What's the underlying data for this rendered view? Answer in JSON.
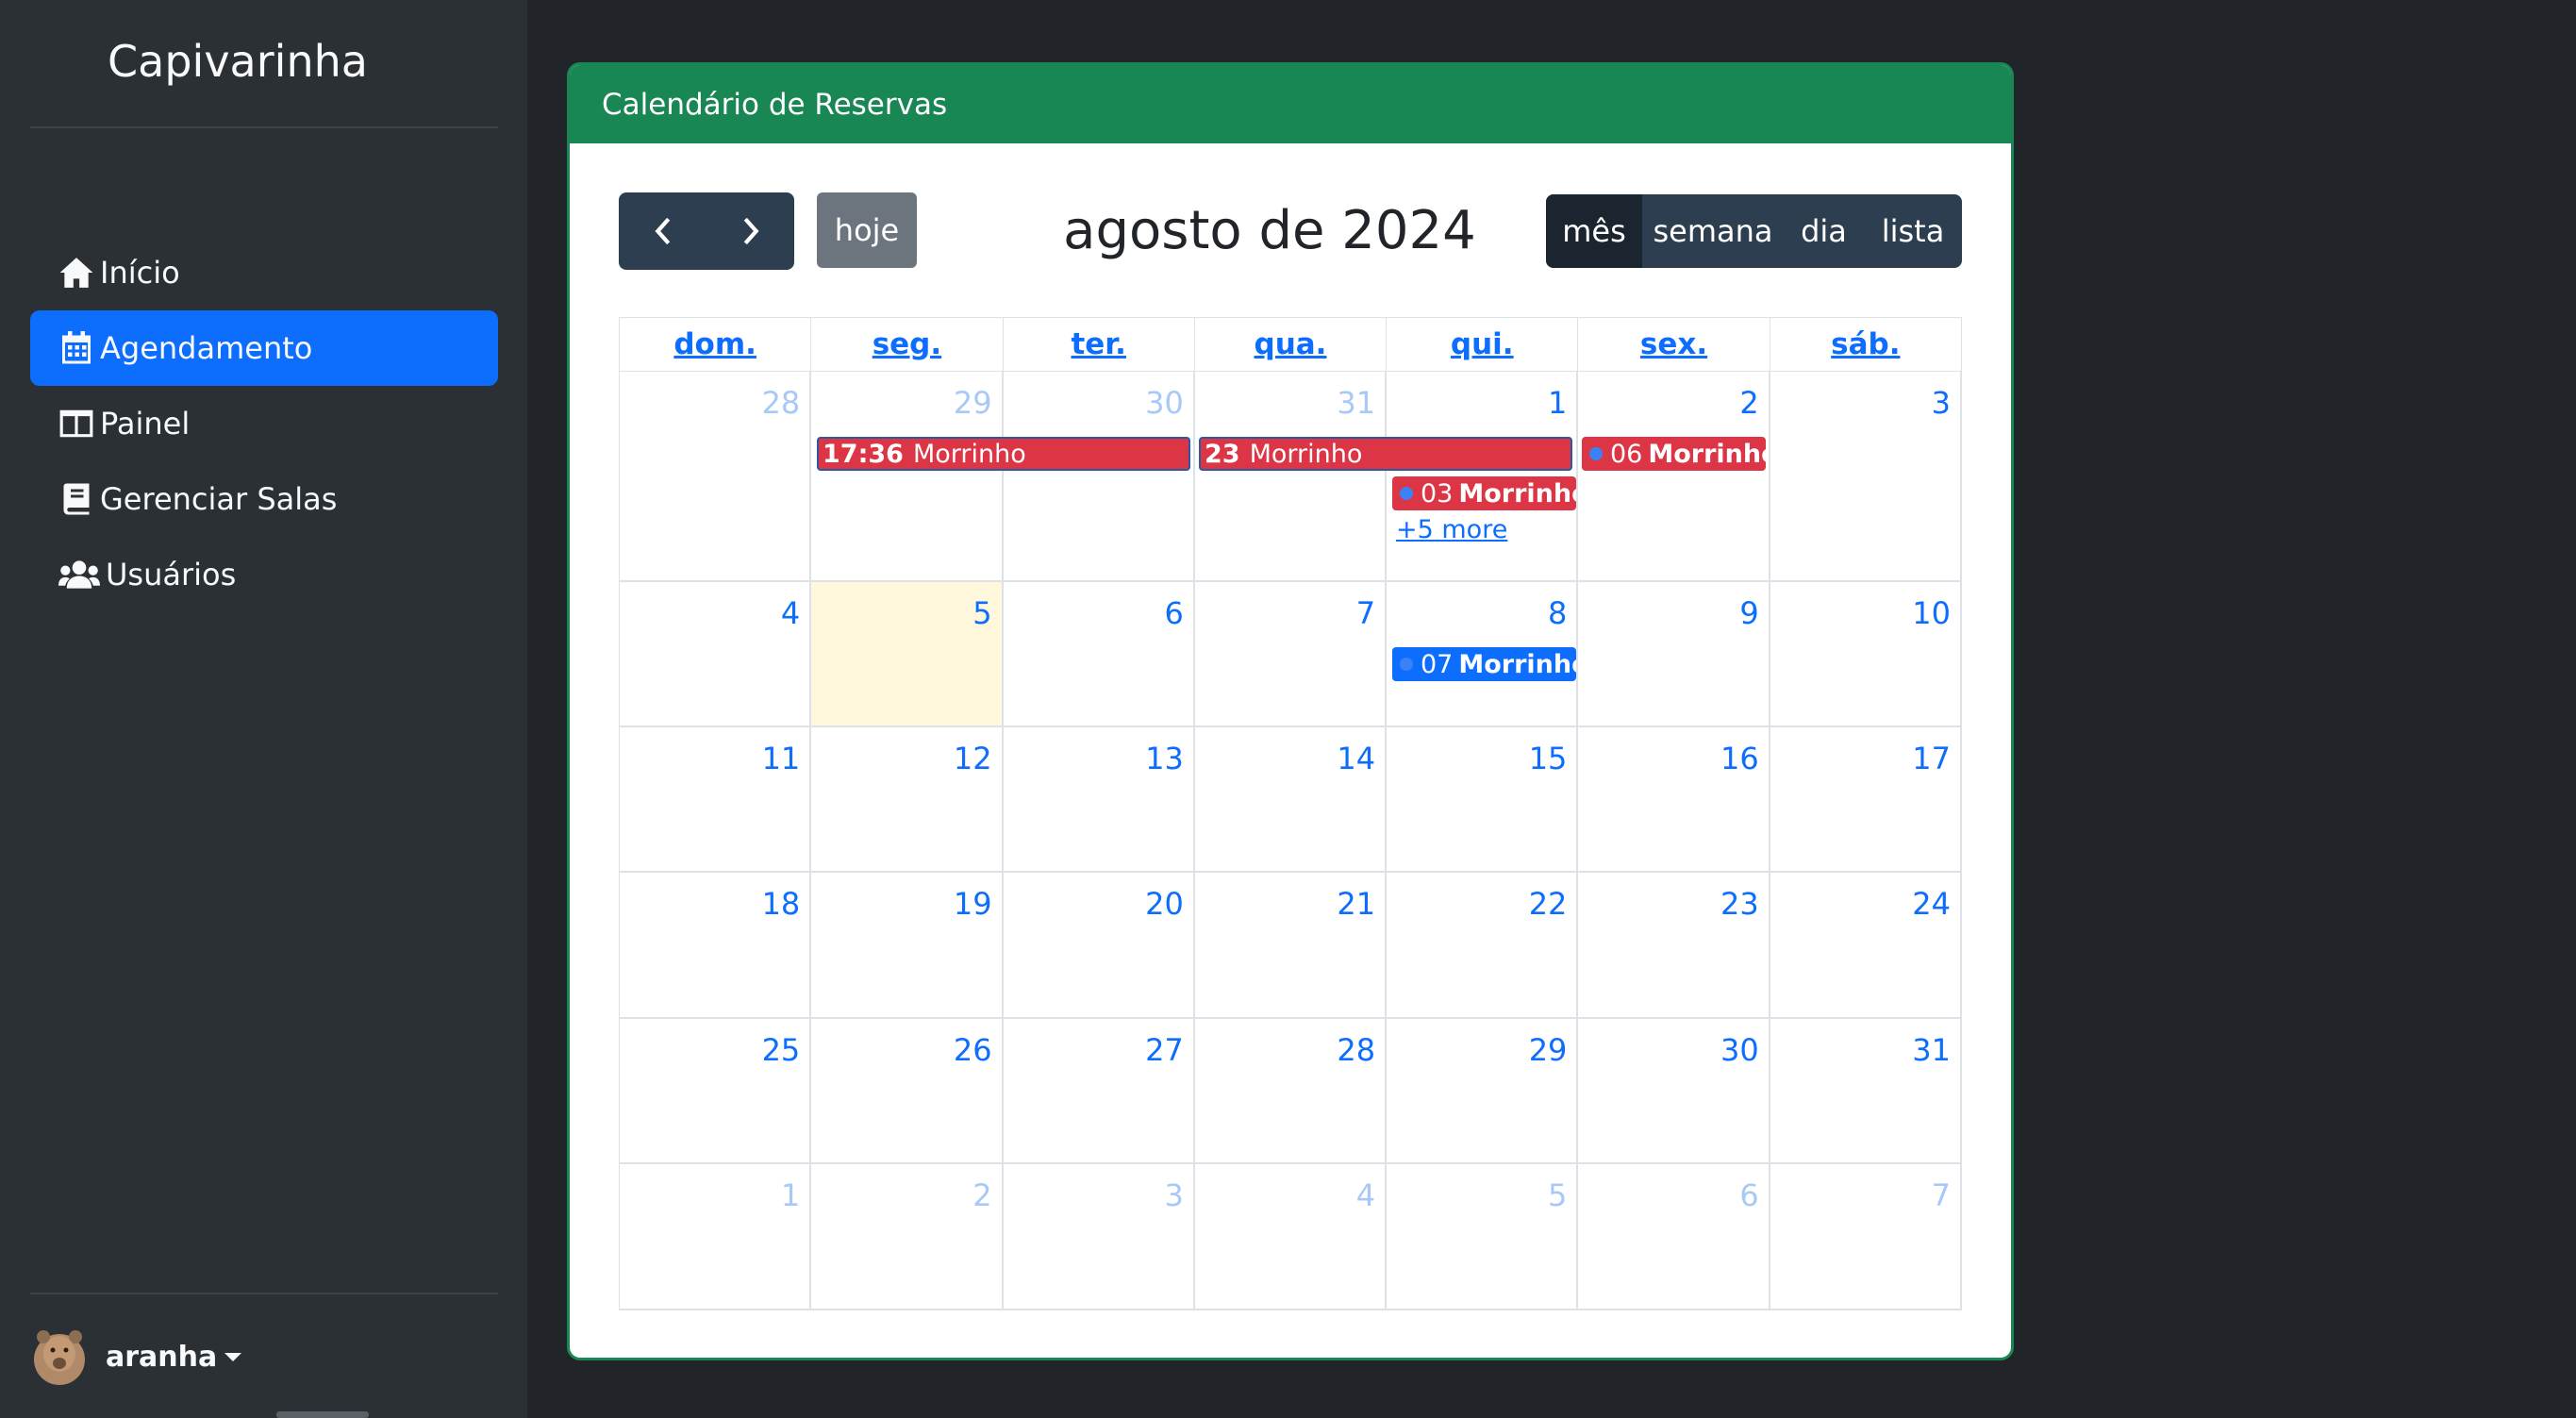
{
  "sidebar": {
    "brand": "Capivarinha",
    "items": [
      {
        "label": "Início",
        "icon": "home-icon"
      },
      {
        "label": "Agendamento",
        "icon": "calendar-icon"
      },
      {
        "label": "Painel",
        "icon": "columns-icon"
      },
      {
        "label": "Gerenciar Salas",
        "icon": "book-icon"
      },
      {
        "label": "Usuários",
        "icon": "users-icon"
      }
    ],
    "user": {
      "name": "aranha"
    }
  },
  "card": {
    "header": "Calendário de Reservas"
  },
  "calendar": {
    "title": "agosto de 2024",
    "today_label": "hoje",
    "views": [
      "mês",
      "semana",
      "dia",
      "lista"
    ],
    "active_view": "mês",
    "weekdays": [
      "dom.",
      "seg.",
      "ter.",
      "qua.",
      "qui.",
      "sex.",
      "sáb."
    ],
    "weeks": [
      [
        "28",
        "29",
        "30",
        "31",
        "1",
        "2",
        "3"
      ],
      [
        "4",
        "5",
        "6",
        "7",
        "8",
        "9",
        "10"
      ],
      [
        "11",
        "12",
        "13",
        "14",
        "15",
        "16",
        "17"
      ],
      [
        "18",
        "19",
        "20",
        "21",
        "22",
        "23",
        "24"
      ],
      [
        "25",
        "26",
        "27",
        "28",
        "29",
        "30",
        "31"
      ],
      [
        "1",
        "2",
        "3",
        "4",
        "5",
        "6",
        "7"
      ]
    ],
    "today_date": "5",
    "events": {
      "e1": {
        "time": "17:36",
        "title": "Morrinho"
      },
      "e2": {
        "time": "23",
        "title": "Morrinho"
      },
      "e3": {
        "time": "06",
        "title": "Morrinho"
      },
      "e4": {
        "time": "03",
        "title": "Morrinho"
      },
      "e5": {
        "time": "07",
        "title": "Morrinho"
      }
    },
    "more_link": "+5 more"
  },
  "colors": {
    "accent": "#0d6efd",
    "header_green": "#198754",
    "event_red": "#dc3545",
    "event_blue": "#0d6efd",
    "today_bg": "#fff8dc"
  }
}
